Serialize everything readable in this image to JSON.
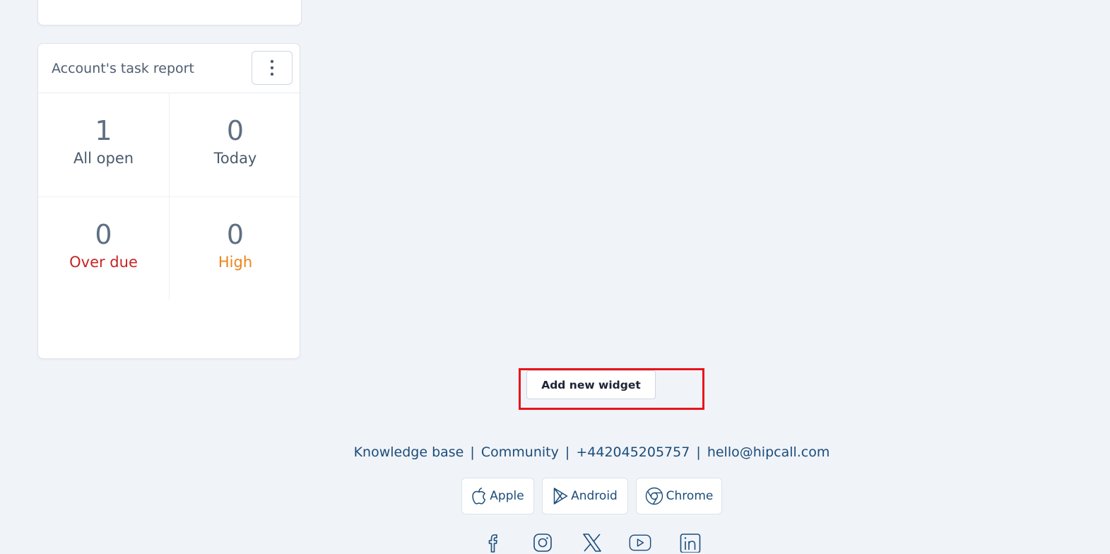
{
  "task_report": {
    "title": "Account's task report",
    "menu_icon": "kebab-menu-icon",
    "stats": [
      {
        "value": "1",
        "label": "All open",
        "label_color": "#4b5a6c"
      },
      {
        "value": "0",
        "label": "Today",
        "label_color": "#4b5a6c"
      },
      {
        "value": "0",
        "label": "Over due",
        "label_color": "#c62424"
      },
      {
        "value": "0",
        "label": "High",
        "label_color": "#ee8418"
      }
    ]
  },
  "add_widget": {
    "label": "Add new widget",
    "highlight_color": "#e8141c"
  },
  "footer": {
    "links": [
      {
        "label": "Knowledge base"
      },
      {
        "label": "Community"
      },
      {
        "label": "+442045205757"
      },
      {
        "label": "hello@hipcall.com"
      }
    ],
    "separator": "|",
    "apps": [
      {
        "label": "Apple",
        "icon": "apple-icon"
      },
      {
        "label": "Android",
        "icon": "android-play-icon"
      },
      {
        "label": "Chrome",
        "icon": "chrome-icon"
      }
    ],
    "social": [
      {
        "icon": "facebook-icon"
      },
      {
        "icon": "instagram-icon"
      },
      {
        "icon": "x-twitter-icon"
      },
      {
        "icon": "youtube-icon"
      },
      {
        "icon": "linkedin-icon"
      }
    ],
    "color": "#1b4d79"
  }
}
